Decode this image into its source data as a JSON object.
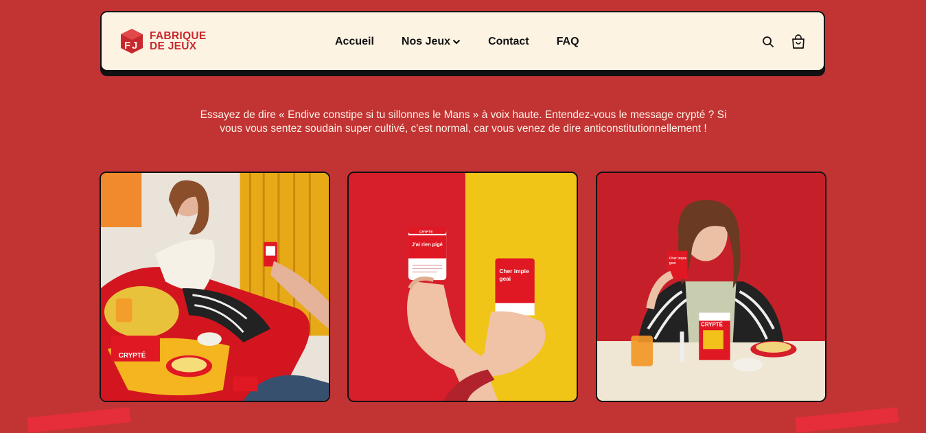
{
  "brand": {
    "line1": "FABRIQUE",
    "line2": "DE JEUX",
    "color": "#c8282d"
  },
  "nav": {
    "items": [
      {
        "label": "Accueil"
      },
      {
        "label": "Nos Jeux"
      },
      {
        "label": "Contact"
      },
      {
        "label": "FAQ"
      }
    ],
    "icons": [
      "search-icon",
      "cart-icon"
    ]
  },
  "intro": {
    "text": "Essayez de dire « Endive constipe si tu sillonnes le Mans » à voix haute. Entendez-vous le message crypté ? Si vous vous sentez soudain super cultivé, c'est normal, car vous venez de dire anticonstitutionnellement !"
  },
  "photos": {
    "card1": {
      "box_label": "CRYPTÉ"
    },
    "card2": {
      "card_a_brand": "CRYPTÉ",
      "card_a_title": "J'ai rien pigé",
      "card_b_title1": "Cher impie",
      "card_b_title2": "geai"
    },
    "card3": {
      "card_title1": "Cher impie",
      "card_title2": "geai",
      "box_label": "CRYPTÉ"
    }
  },
  "colors": {
    "background": "#c23334",
    "nav_bg": "#fcf3e3",
    "accent": "#c8282d"
  }
}
